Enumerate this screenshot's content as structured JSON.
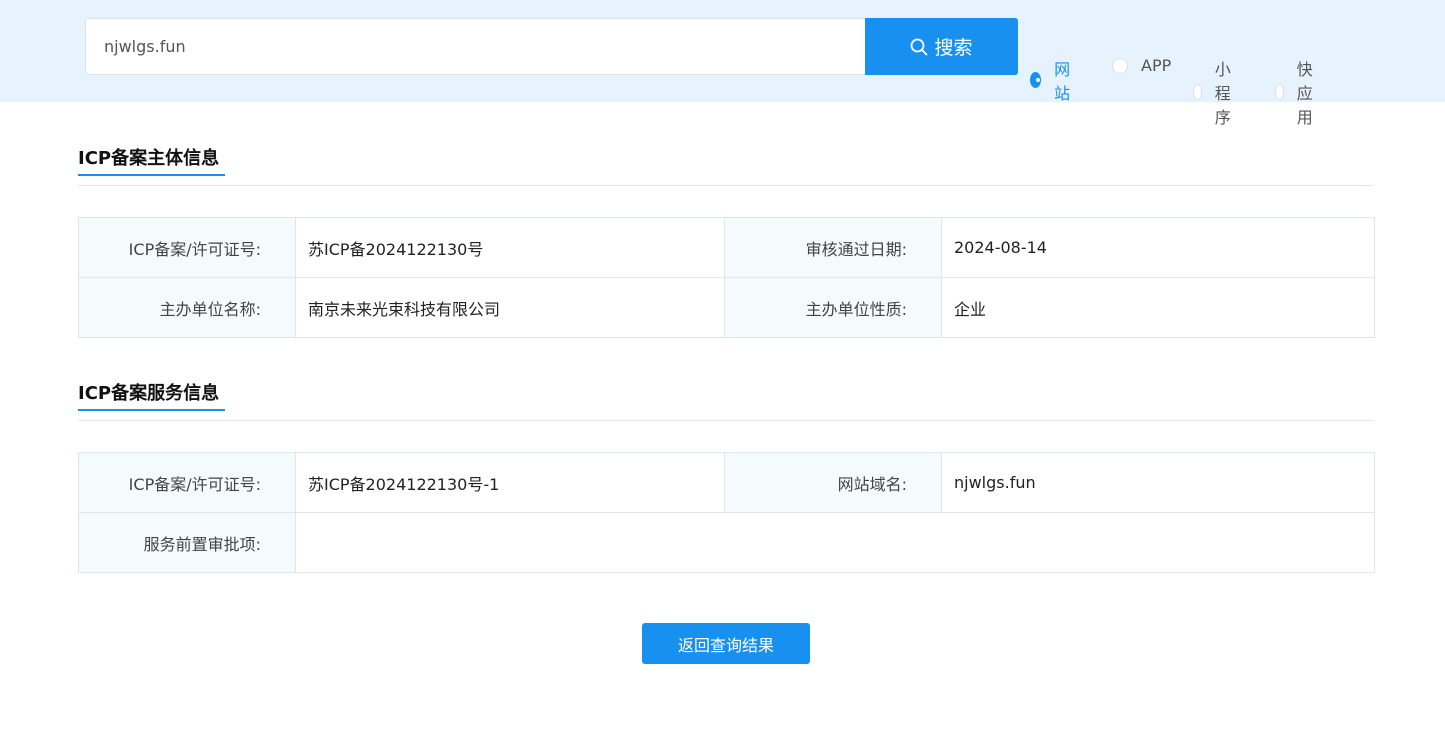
{
  "search": {
    "value": "njwlgs.fun",
    "button_label": "搜索",
    "icon": "search-icon"
  },
  "type_options": [
    {
      "label": "网站",
      "checked": true
    },
    {
      "label": "APP",
      "checked": false
    },
    {
      "label": "小程序",
      "checked": false
    },
    {
      "label": "快应用",
      "checked": false
    }
  ],
  "subject_section": {
    "title": "ICP备案主体信息",
    "rows": [
      {
        "label1": "ICP备案/许可证号:",
        "value1": "苏ICP备2024122130号",
        "label2": "审核通过日期:",
        "value2": "2024-08-14"
      },
      {
        "label1": "主办单位名称:",
        "value1": "南京未来光束科技有限公司",
        "label2": "主办单位性质:",
        "value2": "企业"
      }
    ]
  },
  "service_section": {
    "title": "ICP备案服务信息",
    "row1": {
      "label1": "ICP备案/许可证号:",
      "value1": "苏ICP备2024122130号-1",
      "label2": "网站域名:",
      "value2": "njwlgs.fun"
    },
    "row2": {
      "label": "服务前置审批项:",
      "value": ""
    }
  },
  "back_button_label": "返回查询结果",
  "colors": {
    "accent": "#1890f0",
    "topbar_bg": "#e6f2fd",
    "label_bg": "#f5fafd"
  }
}
